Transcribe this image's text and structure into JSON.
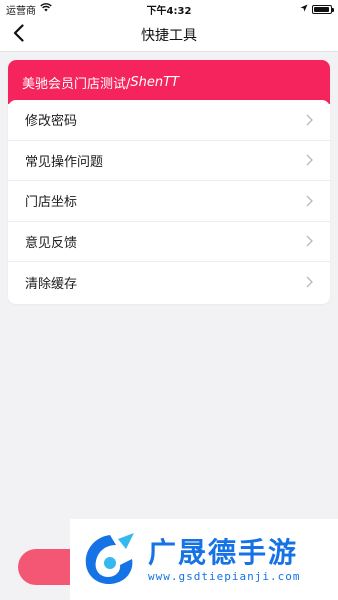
{
  "status_bar": {
    "carrier": "运营商",
    "time": "下午4:32",
    "battery_level": 0.95
  },
  "nav": {
    "title": "快捷工具",
    "back_icon": "chevron-left-icon"
  },
  "store": {
    "name_cjk": "美驰会员门店测试/",
    "name_latin": "ShenTT",
    "header_color": "#f5245c"
  },
  "menu": [
    {
      "label": "修改密码",
      "icon": "chevron-right-icon"
    },
    {
      "label": "常见操作问题",
      "icon": "chevron-right-icon"
    },
    {
      "label": "门店坐标",
      "icon": "chevron-right-icon"
    },
    {
      "label": "意见反馈",
      "icon": "chevron-right-icon"
    },
    {
      "label": "清除缓存",
      "icon": "chevron-right-icon"
    }
  ],
  "watermark": {
    "title": "广晟德手游",
    "url": "www.gsdtiepianji.com",
    "color": "#1673e6"
  }
}
